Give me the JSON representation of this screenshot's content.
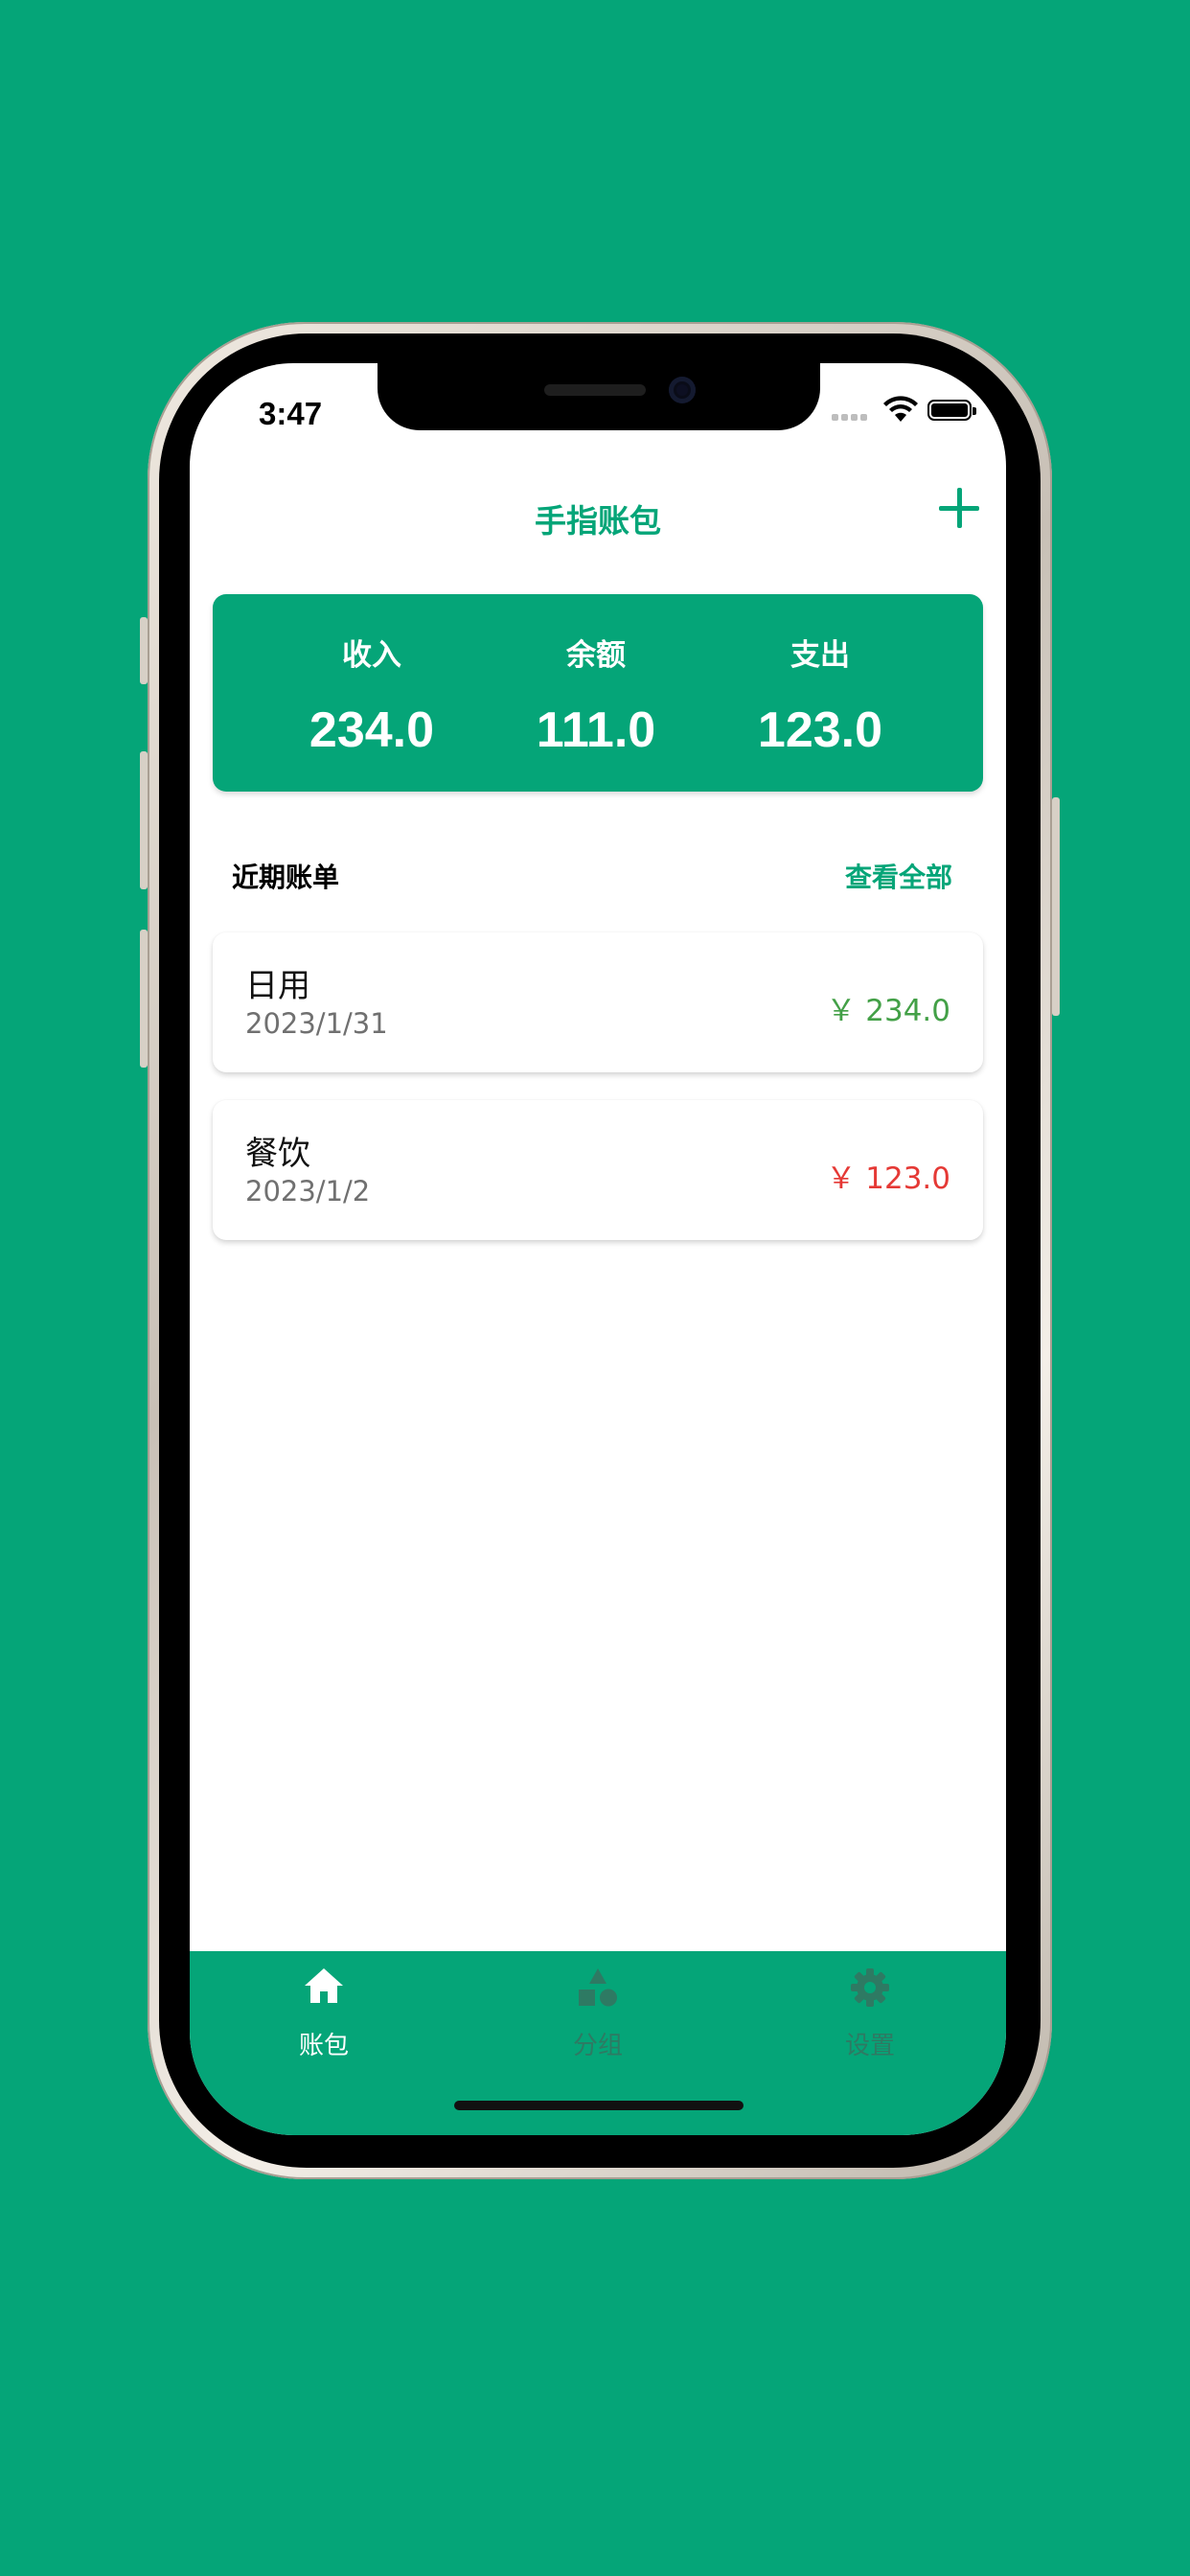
{
  "status_bar": {
    "time": "3:47"
  },
  "header": {
    "title": "手指账包"
  },
  "summary": {
    "income_label": "收入",
    "income_value": "234.0",
    "balance_label": "余额",
    "balance_value": "111.0",
    "expense_label": "支出",
    "expense_value": "123.0"
  },
  "recent": {
    "title": "近期账单",
    "see_all": "查看全部",
    "items": [
      {
        "category": "日用",
        "date": "2023/1/31",
        "amount": "￥ 234.0",
        "type": "income"
      },
      {
        "category": "餐饮",
        "date": "2023/1/2",
        "amount": "￥ 123.0",
        "type": "expense"
      }
    ]
  },
  "tabbar": {
    "tabs": [
      {
        "label": "账包",
        "icon": "home-icon",
        "active": true
      },
      {
        "label": "分组",
        "icon": "shapes-icon",
        "active": false
      },
      {
        "label": "设置",
        "icon": "gear-icon",
        "active": false
      }
    ]
  },
  "colors": {
    "brand": "#05A578",
    "income": "#43A047",
    "expense": "#E53935",
    "tab_active": "#FFFFFF",
    "tab_inactive": "#2E7A63"
  }
}
